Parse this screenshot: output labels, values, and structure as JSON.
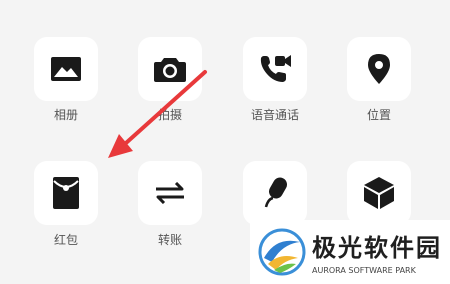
{
  "panel": {
    "items": [
      {
        "label": "相册",
        "icon": "album-icon"
      },
      {
        "label": "拍摄",
        "icon": "camera-icon"
      },
      {
        "label": "语音通话",
        "icon": "voice-call-icon"
      },
      {
        "label": "位置",
        "icon": "location-icon"
      },
      {
        "label": "红包",
        "icon": "red-packet-icon"
      },
      {
        "label": "转账",
        "icon": "transfer-icon"
      },
      {
        "label": "",
        "icon": "microphone-icon"
      },
      {
        "label": "",
        "icon": "cube-icon"
      }
    ]
  },
  "annotation": {
    "arrow_color": "#e8393b"
  },
  "watermark": {
    "title": "极光软件园",
    "subtitle": "AURORA SOFTWARE PARK"
  },
  "colors": {
    "background": "#f4f4f4",
    "tile": "#ffffff",
    "icon": "#1a1a1a",
    "label": "#555555"
  }
}
